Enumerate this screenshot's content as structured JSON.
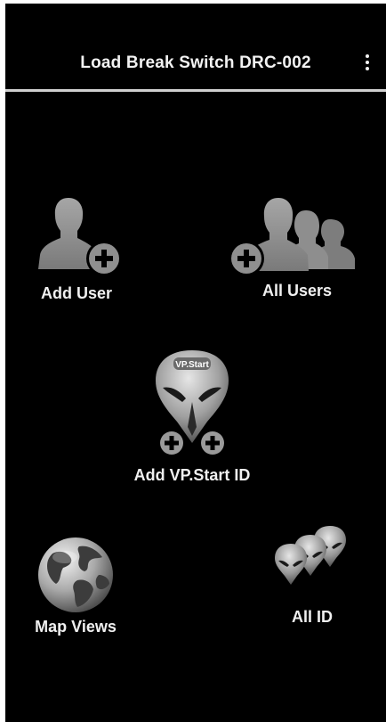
{
  "header": {
    "title": "Load Break Switch DRC-002",
    "menu_icon": "more-vert-icon"
  },
  "tiles": [
    {
      "label": "Add User",
      "icon": "add-user-icon"
    },
    {
      "label": "All Users",
      "icon": "users-group-icon"
    },
    {
      "label": "Add VP.Start ID",
      "icon": "vp-start-add-icon",
      "badge_text": "VP.Start"
    },
    {
      "label": "Map Views",
      "icon": "globe-icon"
    },
    {
      "label": "All ID",
      "icon": "vp-start-stack-icon"
    }
  ],
  "colors": {
    "background": "#000000",
    "text": "#f0f0f0",
    "icon_gray": "#8c8c8c",
    "divider": "#cfcfcf"
  }
}
